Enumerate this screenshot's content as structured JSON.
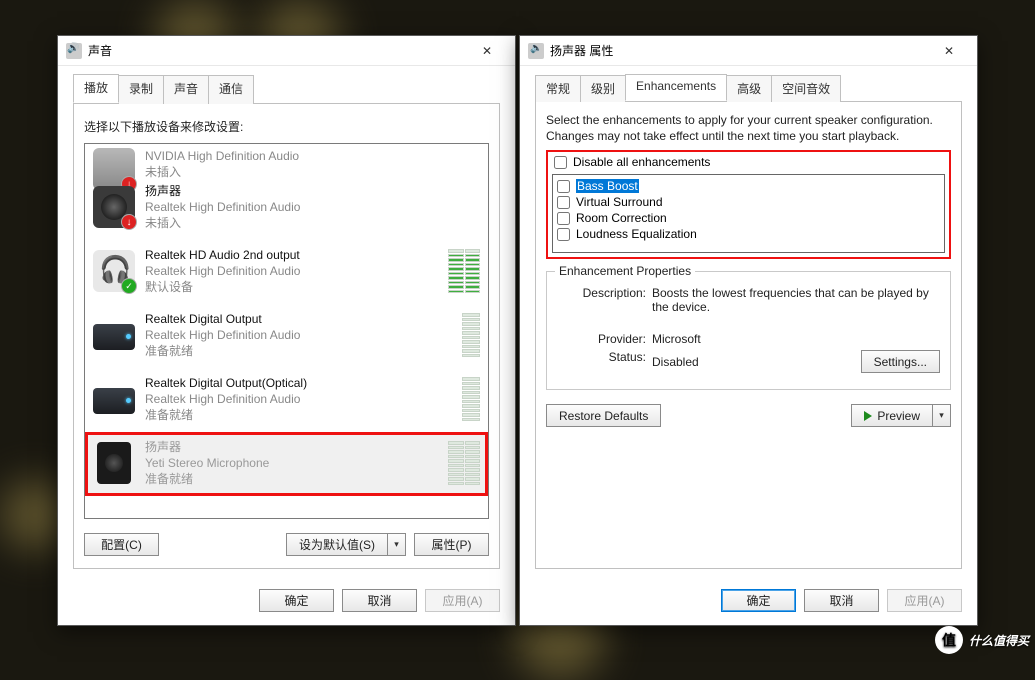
{
  "left": {
    "title": "声音",
    "tabs": [
      "播放",
      "录制",
      "声音",
      "通信"
    ],
    "active_tab": 0,
    "instruction": "选择以下播放设备来修改设置:",
    "devices": [
      {
        "name": "",
        "sub": "NVIDIA High Definition Audio",
        "status": "未插入",
        "icon": "monitor",
        "badge": "err",
        "cut": true,
        "meter": "none"
      },
      {
        "name": "扬声器",
        "sub": "Realtek High Definition Audio",
        "status": "未插入",
        "icon": "speaker",
        "badge": "err",
        "meter": "none"
      },
      {
        "name": "Realtek HD Audio 2nd output",
        "sub": "Realtek High Definition Audio",
        "status": "默认设备",
        "icon": "headphones",
        "badge": "ok",
        "meter": "dual-active"
      },
      {
        "name": "Realtek Digital Output",
        "sub": "Realtek High Definition Audio",
        "status": "准备就绪",
        "icon": "av",
        "badge": "",
        "meter": "single"
      },
      {
        "name": "Realtek Digital Output(Optical)",
        "sub": "Realtek High Definition Audio",
        "status": "准备就绪",
        "icon": "av",
        "badge": "",
        "meter": "single"
      },
      {
        "name": "扬声器",
        "sub": "Yeti Stereo Microphone",
        "status": "准备就绪",
        "icon": "yeti",
        "badge": "",
        "meter": "dual",
        "selected": true
      }
    ],
    "buttons": {
      "configure": "配置(C)",
      "setdefault": "设为默认值(S)",
      "properties": "属性(P)"
    },
    "dlg": {
      "ok": "确定",
      "cancel": "取消",
      "apply": "应用(A)"
    }
  },
  "right": {
    "title": "扬声器 属性",
    "tabs": [
      "常规",
      "级别",
      "Enhancements",
      "高级",
      "空间音效"
    ],
    "active_tab": 2,
    "desc": "Select the enhancements to apply for your current speaker configuration. Changes may not take effect until the next time you start playback.",
    "disable_all": "Disable all enhancements",
    "enhancements": [
      {
        "label": "Bass Boost",
        "selected": true
      },
      {
        "label": "Virtual Surround"
      },
      {
        "label": "Room Correction"
      },
      {
        "label": "Loudness Equalization"
      }
    ],
    "props": {
      "title": "Enhancement Properties",
      "desc_k": "Description:",
      "desc_v": "Boosts the lowest frequencies that can be played by the device.",
      "provider_k": "Provider:",
      "provider_v": "Microsoft",
      "status_k": "Status:",
      "status_v": "Disabled",
      "settings": "Settings..."
    },
    "restore": "Restore Defaults",
    "preview": "Preview",
    "dlg": {
      "ok": "确定",
      "cancel": "取消",
      "apply": "应用(A)"
    }
  },
  "watermark": "什么值得买",
  "watermark_badge": "值"
}
